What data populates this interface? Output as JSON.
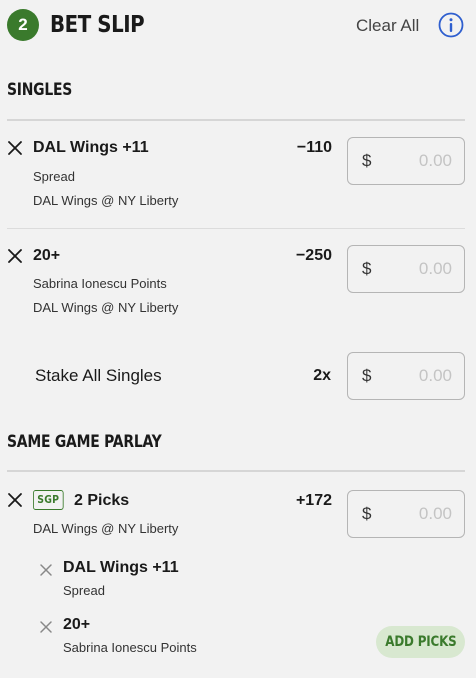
{
  "header": {
    "count": "2",
    "title": "BET SLIP",
    "clear_all": "Clear All",
    "info_icon": "info-circle-icon"
  },
  "singles": {
    "heading": "SINGLES",
    "bets": [
      {
        "title": "DAL Wings +11",
        "market": "Spread",
        "matchup": "DAL Wings @ NY Liberty",
        "odds": "−110",
        "currency": "$",
        "placeholder": "0.00"
      },
      {
        "title": "20+",
        "market": "Sabrina Ionescu Points",
        "matchup": "DAL Wings @ NY Liberty",
        "odds": "−250",
        "currency": "$",
        "placeholder": "0.00"
      }
    ],
    "stake_all": {
      "label": "Stake All Singles",
      "multiplier": "2x",
      "currency": "$",
      "placeholder": "0.00"
    }
  },
  "sgp": {
    "heading": "SAME GAME PARLAY",
    "badge": "SGP",
    "title": "2 Picks",
    "matchup": "DAL Wings @ NY Liberty",
    "odds": "+172",
    "currency": "$",
    "placeholder": "0.00",
    "legs": [
      {
        "title": "DAL Wings +11",
        "market": "Spread"
      },
      {
        "title": "20+",
        "market": "Sabrina Ionescu Points"
      }
    ],
    "add_picks": "ADD PICKS"
  },
  "colors": {
    "brand_green": "#3a7a2c",
    "info_blue": "#2f5fcf",
    "background": "#f2f2f2"
  }
}
